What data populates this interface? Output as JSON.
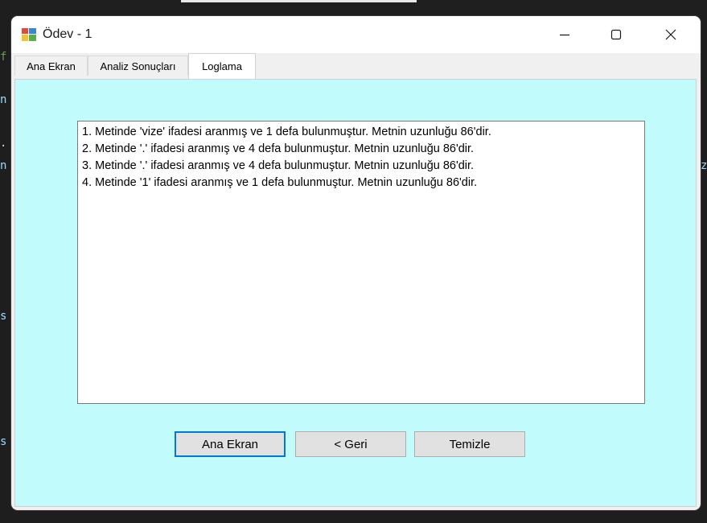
{
  "window": {
    "title": "Ödev - 1",
    "controls": {
      "minimize": "—",
      "maximize": "☐",
      "close": "✕"
    }
  },
  "tabs": [
    {
      "label": "Ana Ekran",
      "active": false
    },
    {
      "label": "Analiz Sonuçları",
      "active": false
    },
    {
      "label": "Loglama",
      "active": true
    }
  ],
  "log": {
    "lines": [
      "1. Metinde 'vize' ifadesi aranmış ve 1 defa bulunmuştur. Metnin uzunluğu 86'dir.",
      "2. Metinde '.' ifadesi aranmış ve 4 defa bulunmuştur. Metnin uzunluğu 86'dir.",
      "3. Metinde '.' ifadesi aranmış ve 4 defa bulunmuştur. Metnin uzunluğu 86'dir.",
      "4. Metinde '1' ifadesi aranmış ve 1 defa bulunmuştur. Metnin uzunluğu 86'dir."
    ]
  },
  "buttons": {
    "home": "Ana Ekran",
    "back": "< Geri",
    "clear": "Temizle"
  },
  "background_code": [
    "f",
    "n",
    ".",
    "n",
    "s",
    "s",
    "z"
  ],
  "colors": {
    "panel_bg": "#c2fbfc",
    "focus_border": "#0078d7",
    "button_bg": "#e1e1e1"
  }
}
